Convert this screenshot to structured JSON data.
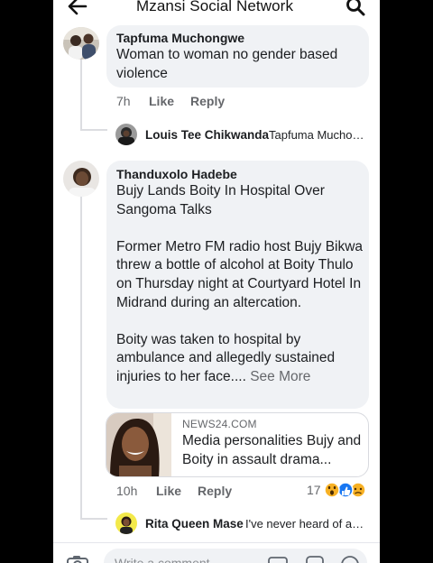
{
  "header": {
    "title": "Mzansi Social Network",
    "back_icon": "back-arrow-icon",
    "search_icon": "search-icon"
  },
  "comments": [
    {
      "author": "Tapfuma Muchongwe",
      "text": "Woman to woman no gender based violence",
      "time": "7h",
      "like_label": "Like",
      "reply_label": "Reply",
      "replies": [
        {
          "author": "Louis Tee Chikwanda",
          "snippet": "Tapfuma Muchongwe"
        }
      ]
    },
    {
      "author": "Thanduxolo Hadebe",
      "paragraphs": [
        "Bujy Lands Boity In Hospital Over Sangoma Talks",
        "Former Metro FM radio host Bujy Bikwa threw a bottle of alcohol at Boity Thulo on Thursday night at Courtyard Hotel In Midrand during an altercation.",
        "Boity was taken to hospital by ambulance and allegedly sustained injuries to her face...."
      ],
      "see_more": "See More",
      "link_preview": {
        "domain": "NEWS24.COM",
        "title": "Media personalities Bujy and Boity in assault drama"
      },
      "time": "10h",
      "like_label": "Like",
      "reply_label": "Reply",
      "reaction_count": "17",
      "reaction_icons": [
        "wow-reaction-icon",
        "like-reaction-icon",
        "sad-reaction-icon"
      ],
      "replies": [
        {
          "author": "Rita Queen Mase",
          "snippet": "I've never heard of any"
        }
      ]
    }
  ],
  "composer": {
    "placeholder": "Write a comment..."
  },
  "colors": {
    "bubble": "#f0f2f5",
    "meta_text": "#65676b",
    "like_blue": "#1877f2",
    "wow_yellow": "#f7b125"
  }
}
